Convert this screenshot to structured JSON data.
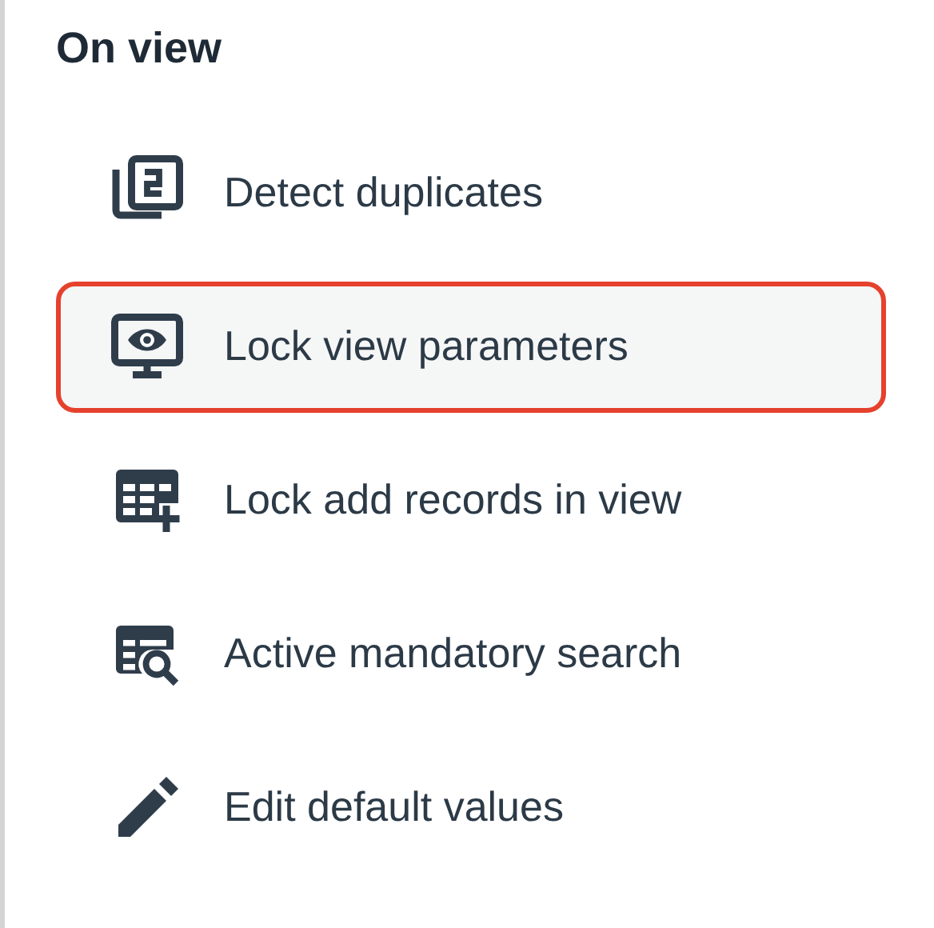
{
  "section": {
    "title": "On view"
  },
  "items": [
    {
      "kind": "duplicates",
      "label": "Detect duplicates",
      "selected": false
    },
    {
      "kind": "monitor",
      "label": "Lock view parameters",
      "selected": true
    },
    {
      "kind": "table-add",
      "label": "Lock add records in view",
      "selected": false
    },
    {
      "kind": "search-list",
      "label": "Active mandatory search",
      "selected": false
    },
    {
      "kind": "pencil",
      "label": "Edit default values",
      "selected": false
    }
  ]
}
